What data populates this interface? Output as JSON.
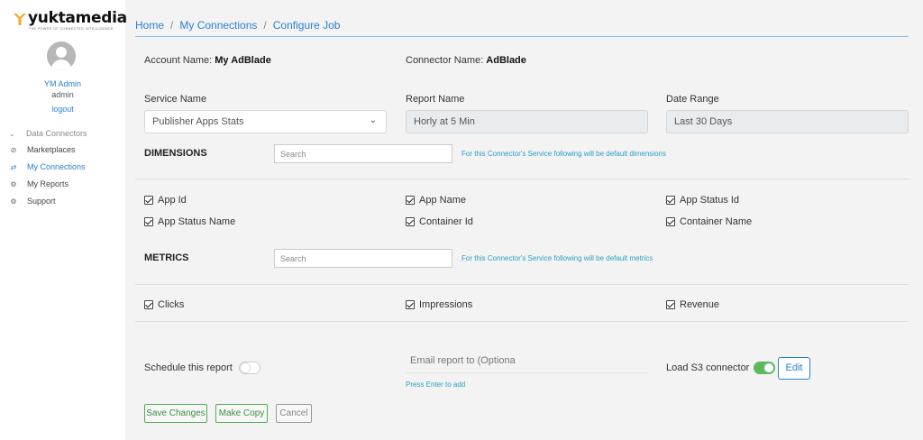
{
  "brand": {
    "name": "yuktamedia",
    "tagline": "THE POWER OF CONNECTED INTELLIGENCE",
    "accent": "#f5a623"
  },
  "user": {
    "name": "YM Admin",
    "role": "admin",
    "logout": "logout"
  },
  "sidebar": {
    "group": "Data Connectors",
    "items": [
      {
        "label": "Marketplaces",
        "icon": "compass-icon"
      },
      {
        "label": "My Connections",
        "icon": "connections-icon",
        "active": true
      },
      {
        "label": "My Reports",
        "icon": "gear-icon"
      },
      {
        "label": "Support",
        "icon": "gear-icon"
      }
    ]
  },
  "breadcrumb": [
    "Home",
    "My Connections",
    "Configure Job"
  ],
  "account": {
    "label": "Account Name:",
    "value": "My AdBlade"
  },
  "connector": {
    "label": "Connector Name:",
    "value": "AdBlade"
  },
  "service": {
    "label": "Service Name",
    "value": "Publisher Apps Stats"
  },
  "report": {
    "label": "Report Name",
    "value": "Horly at 5 Min"
  },
  "date_range": {
    "label": "Date Range",
    "value": "Last 30 Days"
  },
  "dimensions": {
    "title": "DIMENSIONS",
    "search_placeholder": "Search",
    "hint": "For this Connector's Service following will be default dimensions",
    "items": [
      "App Id",
      "App Name",
      "App Status Id",
      "App Status Name",
      "Container Id",
      "Container Name"
    ]
  },
  "metrics": {
    "title": "METRICS",
    "search_placeholder": "Search",
    "hint": "For this Connector's Service following will be default metrics",
    "items": [
      "Clicks",
      "Impressions",
      "Revenue"
    ]
  },
  "schedule": {
    "label": "Schedule this report",
    "enabled": false
  },
  "email": {
    "placeholder": "Email report to (Optiona",
    "hint": "Press Enter to add"
  },
  "s3": {
    "label": "Load S3 connector",
    "enabled": true,
    "edit_label": "Edit"
  },
  "actions": {
    "save": "Save Changes",
    "copy": "Make Copy",
    "cancel": "Cancel"
  },
  "colors": {
    "link": "#2a7fd4",
    "toggle_on": "#5cb85c",
    "hint": "#2a9fc4"
  }
}
